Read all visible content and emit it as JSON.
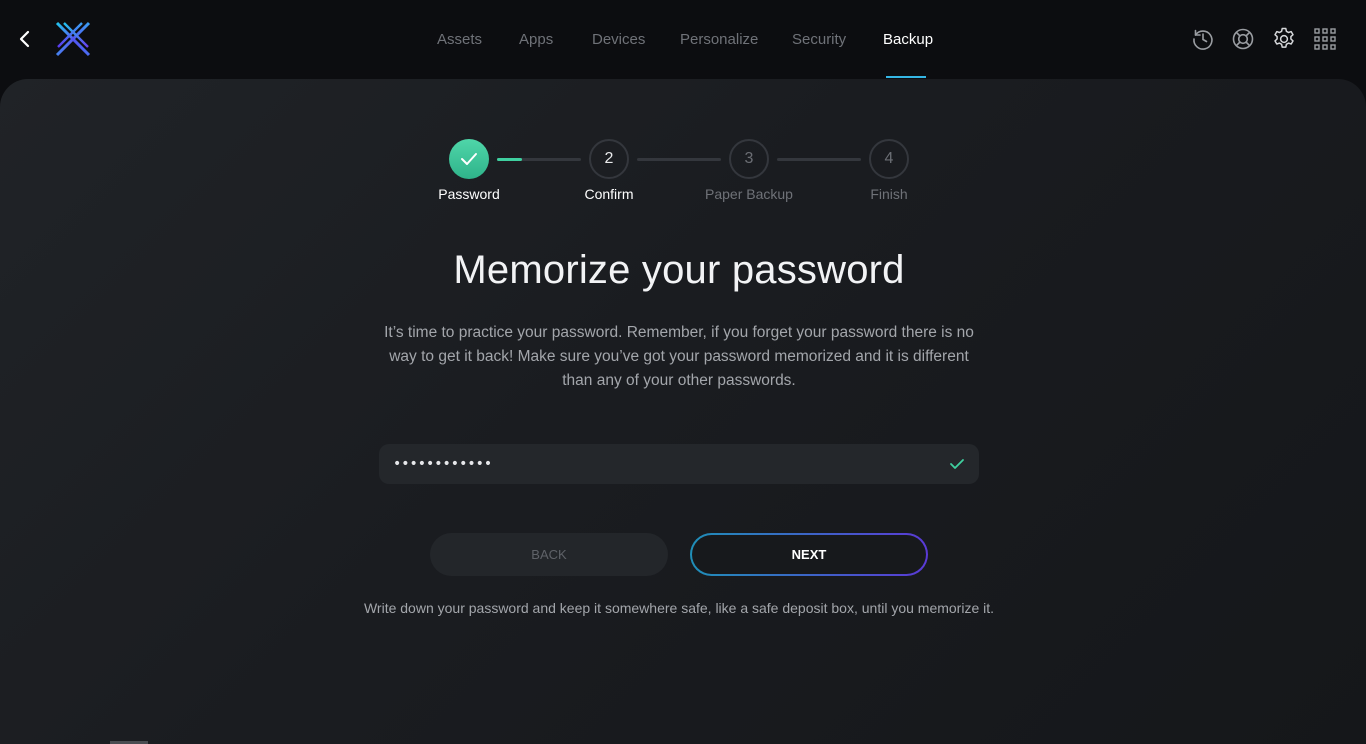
{
  "nav": {
    "tabs": [
      "Assets",
      "Apps",
      "Devices",
      "Personalize",
      "Security",
      "Backup"
    ],
    "active_tab": "Backup"
  },
  "colors": {
    "accent_green": "#3fd0a0",
    "accent_blue": "#34b6e4",
    "accent_purple": "#5a3ad6"
  },
  "icons": {
    "back": "back-arrow-icon",
    "logo": "exodus-logo",
    "history": "history-icon",
    "help": "lifebuoy-icon",
    "settings": "gear-icon",
    "apps": "grid-icon"
  },
  "stepper": {
    "steps": [
      {
        "number": "",
        "label": "Password",
        "state": "done"
      },
      {
        "number": "2",
        "label": "Confirm",
        "state": "current"
      },
      {
        "number": "3",
        "label": "Paper Backup",
        "state": "future"
      },
      {
        "number": "4",
        "label": "Finish",
        "state": "future"
      }
    ],
    "connector_progress": [
      0.3,
      0,
      0
    ]
  },
  "main": {
    "title": "Memorize your password",
    "description": "It’s time to practice your password. Remember, if you forget your password there is no way to get it back! Make sure you’ve got your password memorized and it is different than any of your other passwords.",
    "password_value": "••••••••••••",
    "back_label": "BACK",
    "next_label": "NEXT",
    "footnote": "Write down your password and keep it somewhere safe, like a safe deposit box, until you memorize it."
  }
}
